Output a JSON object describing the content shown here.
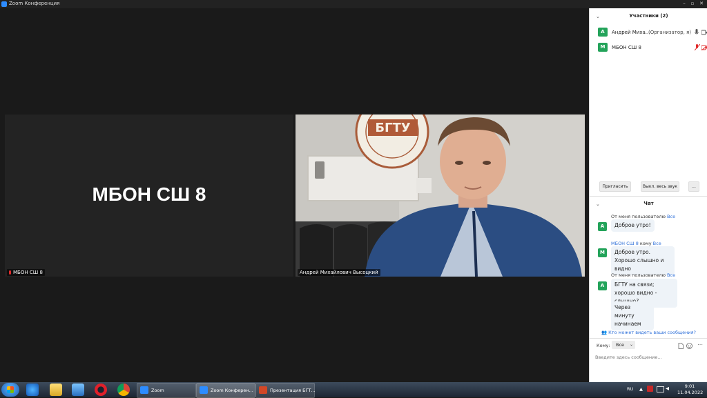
{
  "window": {
    "title": "Zoom Конференция"
  },
  "tiles": {
    "left": {
      "big_name": "МБОН СШ 8",
      "label": "МБОН СШ 8"
    },
    "right": {
      "label": "Андрей Михайлович Высоцкий",
      "logo_text": "БГТУ"
    }
  },
  "participants": {
    "header": "Участники (2)",
    "list": [
      {
        "avatar": "А",
        "name": "Андрей Миха...",
        "role": "(Организатор, я)"
      },
      {
        "avatar": "М",
        "name": "МБОН СШ 8",
        "role": ""
      }
    ],
    "invite_label": "Пригласить",
    "mute_all_label": "Выкл. весь звук",
    "more_label": "..."
  },
  "chat": {
    "header": "Чат",
    "messages": [
      {
        "avatar": "А",
        "from": "От меня пользователю",
        "to": "Все",
        "texts": [
          "Доброе утро!"
        ]
      },
      {
        "avatar": "М",
        "from": "МБОН СШ 8",
        "mid": "кому",
        "to": "Все",
        "texts": [
          "Доброе утро. Хорошо слышно и видно"
        ]
      },
      {
        "avatar": "А",
        "from": "От меня пользователю",
        "to": "Все",
        "texts": [
          "БГТУ на связи; хорошо видно - слышно?",
          "Через минуту начинаем"
        ]
      }
    ],
    "who_can_see": "Кто может видеть ваши сообщения?",
    "to_label": "Кому:",
    "to_value": "Все",
    "input_placeholder": "Введите здесь сообщение..."
  },
  "taskbar": {
    "tasks": [
      {
        "label": "Zoom"
      },
      {
        "label": "Zoom Конферен..."
      },
      {
        "label": "Презентация БГТ..."
      }
    ],
    "lang": "RU",
    "time": "9:01",
    "date": "11.04.2022"
  },
  "colors": {
    "accent": "#2d8cff",
    "avatar_green": "#23a35a",
    "muted_red": "#e02a2a",
    "link_blue": "#2d6fd9"
  }
}
